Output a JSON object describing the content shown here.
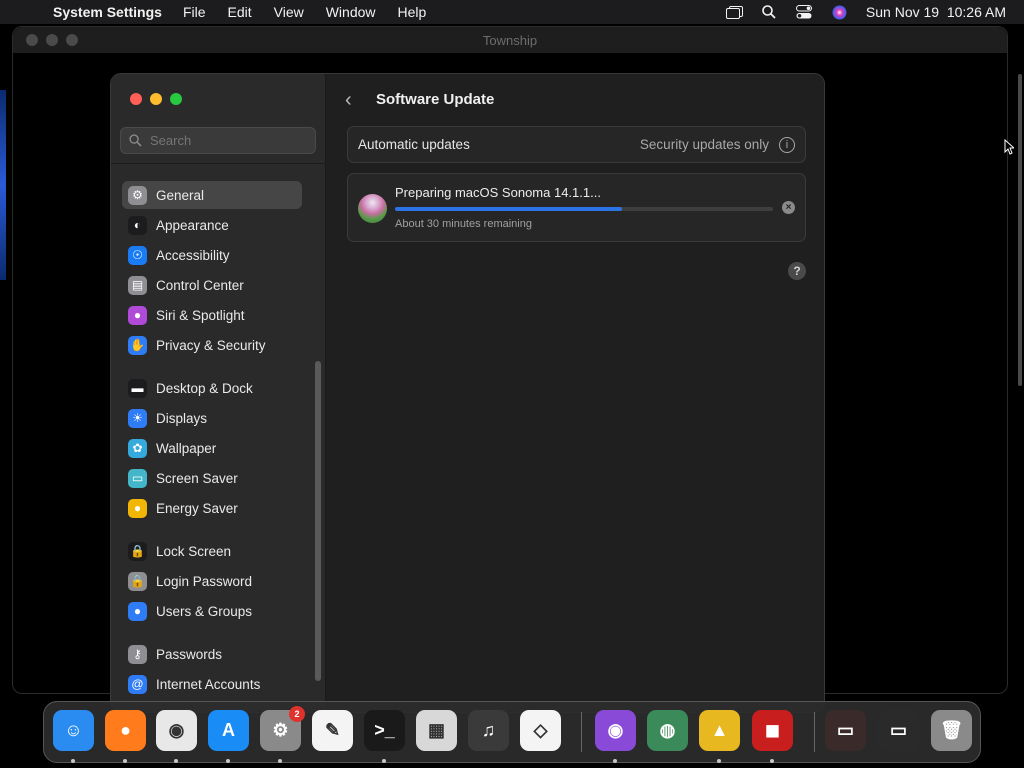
{
  "menubar": {
    "app": "System Settings",
    "items": [
      "File",
      "Edit",
      "View",
      "Window",
      "Help"
    ],
    "clock": "Sun Nov 19  10:26 AM"
  },
  "background_window": {
    "title": "Township"
  },
  "sidebar": {
    "search_placeholder": "Search",
    "items": [
      {
        "label": "General",
        "icon": "gear-icon",
        "color": "#8e8e93",
        "active": true
      },
      {
        "label": "Appearance",
        "icon": "appearance-icon",
        "color": "#1c1c1e"
      },
      {
        "label": "Accessibility",
        "icon": "accessibility-icon",
        "color": "#1a7cf5"
      },
      {
        "label": "Control Center",
        "icon": "control-center-icon",
        "color": "#8e8e93"
      },
      {
        "label": "Siri & Spotlight",
        "icon": "siri-icon",
        "color": "#b04ad8"
      },
      {
        "label": "Privacy & Security",
        "icon": "hand-icon",
        "color": "#2f7df6"
      },
      {
        "label": "Desktop & Dock",
        "icon": "dock-icon",
        "color": "#1c1c1e"
      },
      {
        "label": "Displays",
        "icon": "displays-icon",
        "color": "#2f7df6"
      },
      {
        "label": "Wallpaper",
        "icon": "wallpaper-icon",
        "color": "#35aadc"
      },
      {
        "label": "Screen Saver",
        "icon": "screen-saver-icon",
        "color": "#43b6c9"
      },
      {
        "label": "Energy Saver",
        "icon": "energy-icon",
        "color": "#f2b705"
      },
      {
        "label": "Lock Screen",
        "icon": "lock-icon",
        "color": "#1c1c1e"
      },
      {
        "label": "Login Password",
        "icon": "lock-icon",
        "color": "#8e8e93"
      },
      {
        "label": "Users & Groups",
        "icon": "users-icon",
        "color": "#2f7df6"
      },
      {
        "label": "Passwords",
        "icon": "key-icon",
        "color": "#8e8e93"
      },
      {
        "label": "Internet Accounts",
        "icon": "at-icon",
        "color": "#2f7df6"
      }
    ]
  },
  "main": {
    "title": "Software Update",
    "auto_label": "Automatic updates",
    "auto_value": "Security updates only",
    "update_title": "Preparing macOS Sonoma 14.1.1...",
    "update_progress": 0.6,
    "update_remaining": "About 30 minutes remaining"
  },
  "dock": {
    "badge_count": "2",
    "apps": [
      {
        "name": "finder-icon",
        "color": "#2a8cf0",
        "glyph": "☺",
        "running": true
      },
      {
        "name": "firefox-icon",
        "color": "#ff7b1c",
        "glyph": "●",
        "running": true
      },
      {
        "name": "chrome-icon",
        "color": "#e8e8e8",
        "glyph": "◉",
        "running": true
      },
      {
        "name": "app-store-icon",
        "color": "#1a8cf5",
        "glyph": "A",
        "running": true
      },
      {
        "name": "system-settings-icon",
        "color": "#8a8a8a",
        "glyph": "⚙",
        "running": true
      },
      {
        "name": "textedit-icon",
        "color": "#f4f4f4",
        "glyph": "✎",
        "running": false
      },
      {
        "name": "terminal-icon",
        "color": "#1a1a1a",
        "glyph": ">_",
        "running": true
      },
      {
        "name": "launchpad-icon",
        "color": "#d8d8d8",
        "glyph": "▦",
        "running": false
      },
      {
        "name": "garageband-icon",
        "color": "#3a3a3a",
        "glyph": "♫",
        "running": false
      },
      {
        "name": "vscode-icon",
        "color": "#f4f4f4",
        "glyph": "◇",
        "running": false
      },
      {
        "name": "podcasts-icon",
        "color": "#8a4ad8",
        "glyph": "◉",
        "running": true
      },
      {
        "name": "world-icon",
        "color": "#3a8a5a",
        "glyph": "◍",
        "running": false
      },
      {
        "name": "township-icon",
        "color": "#e8b820",
        "glyph": "▲",
        "running": true
      },
      {
        "name": "photo-booth-icon",
        "color": "#c81e1e",
        "glyph": "◼",
        "running": true
      },
      {
        "name": "hand-mirror-window-icon",
        "color": "#3a2a2a",
        "glyph": "▭",
        "running": false
      },
      {
        "name": "firefox-window-icon",
        "color": "#2a2a2a",
        "glyph": "▭",
        "running": false
      },
      {
        "name": "trash-icon",
        "color": "#8a8a8a",
        "glyph": "🗑",
        "running": false
      }
    ]
  }
}
